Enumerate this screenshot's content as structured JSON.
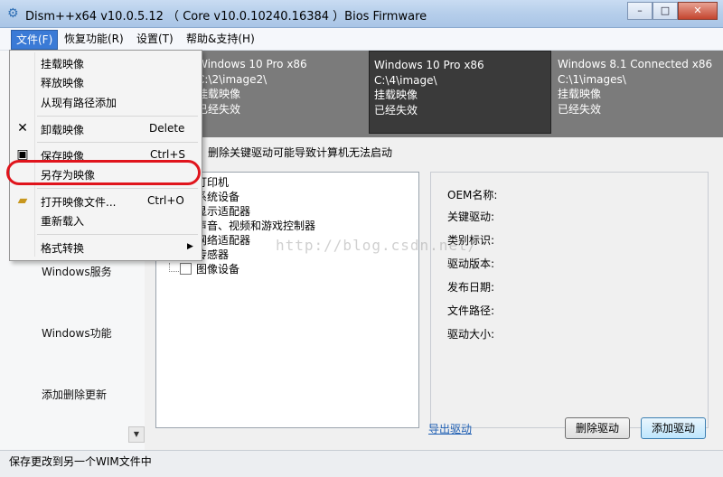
{
  "window": {
    "title": "Dism++x64 v10.0.5.12 （ Core v10.0.10240.16384 ）Bios Firmware",
    "minimize": "–",
    "maximize": "□",
    "close": "✕"
  },
  "menubar": [
    "文件(F)",
    "恢复功能(R)",
    "设置(T)",
    "帮助&支持(H)"
  ],
  "file_menu": {
    "items": [
      {
        "label": "挂载映像",
        "shortcut": ""
      },
      {
        "label": "释放映像",
        "shortcut": ""
      },
      {
        "label": "从现有路径添加",
        "shortcut": ""
      },
      {
        "label": "卸载映像",
        "shortcut": "Delete",
        "icon": "close-x-icon"
      },
      {
        "label": "保存映像",
        "shortcut": "Ctrl+S",
        "icon": "floppy-disk-icon"
      },
      {
        "label": "另存为映像",
        "shortcut": ""
      },
      {
        "label": "打开映像文件...",
        "shortcut": "Ctrl+O",
        "icon": "open-folder-icon"
      },
      {
        "label": "重新载入",
        "shortcut": ""
      },
      {
        "label": "格式转换",
        "shortcut": "",
        "submenu": true
      }
    ]
  },
  "images": [
    {
      "name": "Windows 10 Pro x86",
      "path": "C:\\2\\image2\\",
      "state": "挂载映像",
      "status": "已经失效"
    },
    {
      "name": "Windows 10 Pro x86",
      "path": "C:\\4\\image\\",
      "state": "挂载映像",
      "status": "已经失效"
    },
    {
      "name": "Windows 8.1 Connected x86",
      "path": "C:\\1\\images\\",
      "state": "挂载映像",
      "status": "已经失效"
    }
  ],
  "sidebar": {
    "items": [
      "Windows服务",
      "Windows功能",
      "添加删除更新"
    ]
  },
  "drivers": {
    "warning": "删除关键驱动可能导致计算机无法启动",
    "tree": [
      "打印机",
      "系统设备",
      "显示适配器",
      "声音、视频和游戏控制器",
      "网络适配器",
      "传感器",
      "图像设备"
    ],
    "info_labels": [
      "OEM名称:",
      "关键驱动:",
      "类别标识:",
      "驱动版本:",
      "发布日期:",
      "文件路径:",
      "驱动大小:"
    ],
    "export_link": "导出驱动",
    "delete_button": "删除驱动",
    "add_button": "添加驱动"
  },
  "status": "保存更改到另一个WIM文件中",
  "watermark": "http://blog.csdn.net/"
}
